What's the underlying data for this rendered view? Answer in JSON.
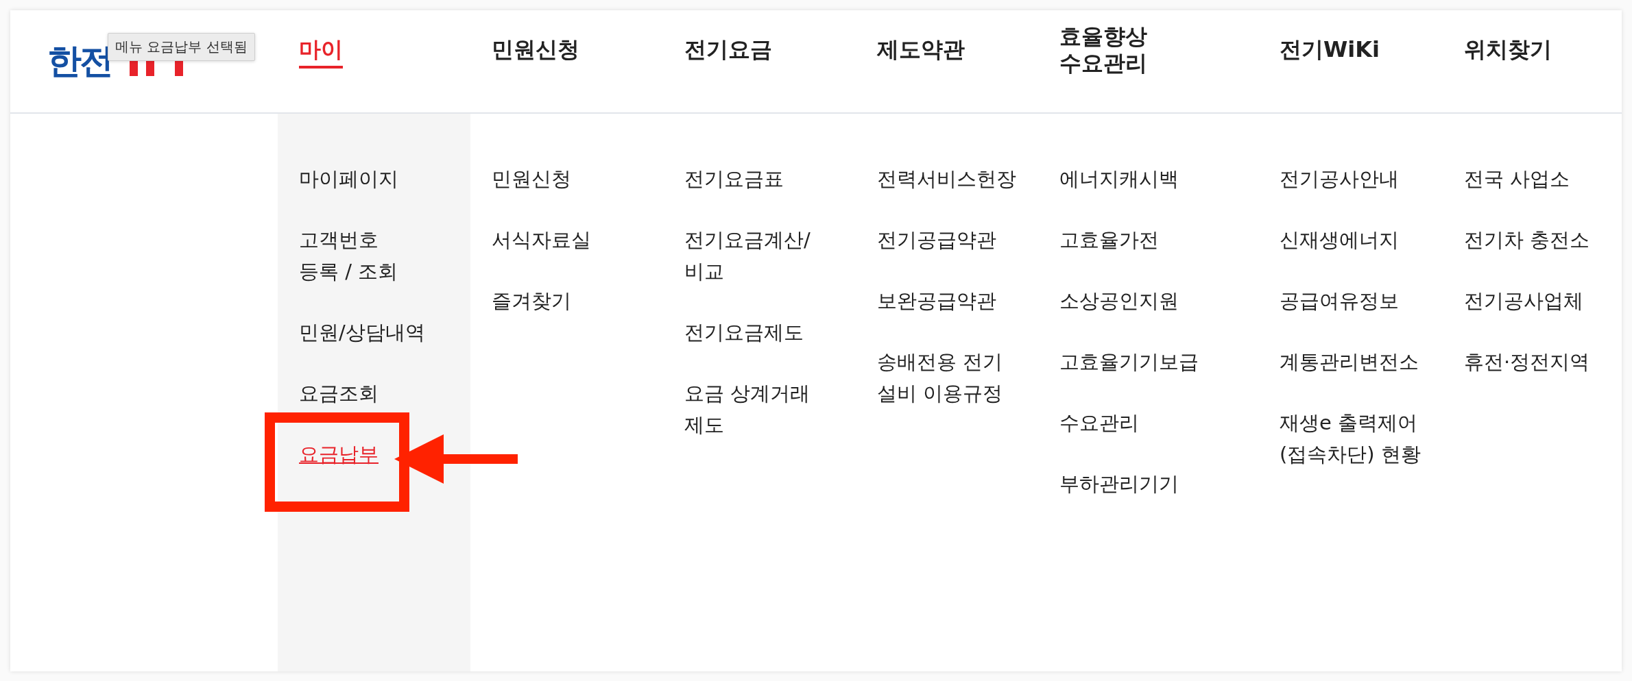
{
  "logo": {
    "text": "한전"
  },
  "tooltip": "메뉴 요금납부 선택됨",
  "menus": [
    {
      "label": "마이",
      "selected": true,
      "items": [
        {
          "label": "마이페이지",
          "selected": false
        },
        {
          "label": "고객번호\n등록 / 조회",
          "selected": false
        },
        {
          "label": "민원/상담내역",
          "selected": false
        },
        {
          "label": "요금조회",
          "selected": false
        },
        {
          "label": "요금납부",
          "selected": true
        }
      ]
    },
    {
      "label": "민원신청",
      "selected": false,
      "items": [
        {
          "label": "민원신청",
          "selected": false
        },
        {
          "label": "서식자료실",
          "selected": false
        },
        {
          "label": "즐겨찾기",
          "selected": false
        }
      ]
    },
    {
      "label": "전기요금",
      "selected": false,
      "items": [
        {
          "label": "전기요금표",
          "selected": false
        },
        {
          "label": "전기요금계산/\n비교",
          "selected": false
        },
        {
          "label": "전기요금제도",
          "selected": false
        },
        {
          "label": "요금 상계거래\n제도",
          "selected": false
        }
      ]
    },
    {
      "label": "제도약관",
      "selected": false,
      "items": [
        {
          "label": "전력서비스헌장",
          "selected": false
        },
        {
          "label": "전기공급약관",
          "selected": false
        },
        {
          "label": "보완공급약관",
          "selected": false
        },
        {
          "label": "송배전용 전기\n설비 이용규정",
          "selected": false
        }
      ]
    },
    {
      "label": "효율향상\n수요관리",
      "selected": false,
      "items": [
        {
          "label": "에너지캐시백",
          "selected": false
        },
        {
          "label": "고효율가전",
          "selected": false
        },
        {
          "label": "소상공인지원",
          "selected": false
        },
        {
          "label": "고효율기기보급",
          "selected": false
        },
        {
          "label": "수요관리",
          "selected": false
        },
        {
          "label": "부하관리기기",
          "selected": false
        }
      ]
    },
    {
      "label": "전기WiKi",
      "selected": false,
      "items": [
        {
          "label": "전기공사안내",
          "selected": false
        },
        {
          "label": "신재생에너지",
          "selected": false
        },
        {
          "label": "공급여유정보",
          "selected": false
        },
        {
          "label": "계통관리변전소",
          "selected": false
        },
        {
          "label": "재생e 출력제어\n(접속차단) 현황",
          "selected": false
        }
      ]
    },
    {
      "label": "위치찾기",
      "selected": false,
      "items": [
        {
          "label": "전국 사업소",
          "selected": false
        },
        {
          "label": "전기차 충전소",
          "selected": false
        },
        {
          "label": "전기공사업체",
          "selected": false
        },
        {
          "label": "휴전·정전지역",
          "selected": false
        }
      ]
    }
  ]
}
